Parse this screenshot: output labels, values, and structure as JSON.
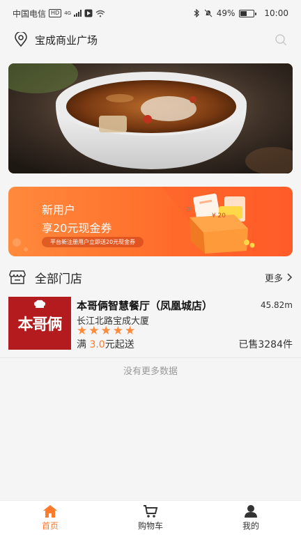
{
  "status_bar": {
    "carrier": "中国电信",
    "hd": "HD",
    "net": "4G",
    "battery_pct": "49%",
    "battery_level": 0.49,
    "time": "10:00"
  },
  "header": {
    "location": "宝成商业广场",
    "location_icon": "location-pin-icon",
    "search_icon": "search-icon"
  },
  "promo": {
    "line1": "新用户",
    "line2": "享20元现金券",
    "note": "平台新注册用户立即送20元现金券",
    "coupon_value": "¥ 20",
    "coupon_small": "20"
  },
  "section": {
    "title": "全部门店",
    "more": "更多",
    "icon": "store-icon"
  },
  "stores": [
    {
      "logo_text": "本哥俩",
      "name": "本哥俩智慧餐厅（凤凰城店）",
      "distance": "45.82m",
      "address": "长江北路宝成大厦",
      "rating": 5,
      "min_prefix": "满 ",
      "min_amount": "3.0",
      "min_suffix": "元起送",
      "sold": "已售3284件"
    }
  ],
  "list_end": "没有更多数据",
  "tabbar": {
    "items": [
      {
        "label": "首页",
        "icon": "home-icon",
        "active": true
      },
      {
        "label": "购物车",
        "icon": "cart-icon",
        "active": false
      },
      {
        "label": "我的",
        "icon": "user-icon",
        "active": false
      }
    ]
  },
  "colors": {
    "accent": "#ff7a2a",
    "logo_red": "#b31b1e"
  }
}
